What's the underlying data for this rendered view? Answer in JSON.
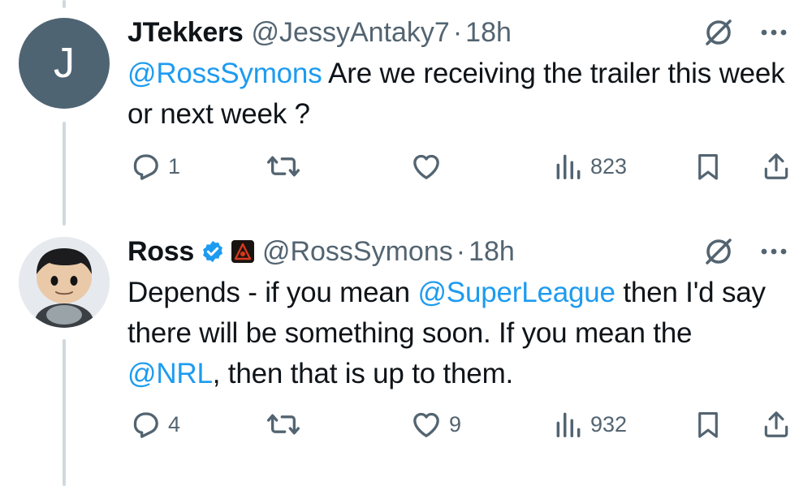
{
  "colors": {
    "accent": "#1d9bf0",
    "muted": "#536471",
    "text": "#0f1419"
  },
  "tweets": [
    {
      "avatar_letter": "J",
      "name": "JTekkers",
      "handle": "@JessyAntaky7",
      "separator": "·",
      "time": "18h",
      "body": [
        {
          "type": "mention",
          "text": "@RossSymons"
        },
        {
          "type": "text",
          "text": " Are we receiving the trailer this week or next week ?"
        }
      ],
      "replies": "1",
      "retweets": "",
      "likes": "",
      "views": "823",
      "icons": [
        "grok-icon",
        "more-icon",
        "reply-icon",
        "retweet-icon",
        "like-icon",
        "views-icon",
        "bookmark-icon",
        "share-icon"
      ]
    },
    {
      "avatar_letter": "",
      "name": "Ross",
      "verified": true,
      "handle": "@RossSymons",
      "separator": "·",
      "time": "18h",
      "body": [
        {
          "type": "text",
          "text": "Depends - if you mean "
        },
        {
          "type": "mention",
          "text": "@SuperLeague"
        },
        {
          "type": "text",
          "text": " then I'd say there will be something soon. If you mean the "
        },
        {
          "type": "mention",
          "text": "@NRL"
        },
        {
          "type": "text",
          "text": ", then that is up to them."
        }
      ],
      "replies": "4",
      "retweets": "",
      "likes": "9",
      "views": "932",
      "icons": [
        "verified-badge-icon",
        "affiliation-badge-icon",
        "grok-icon",
        "more-icon",
        "reply-icon",
        "retweet-icon",
        "like-icon",
        "views-icon",
        "bookmark-icon",
        "share-icon"
      ]
    }
  ]
}
